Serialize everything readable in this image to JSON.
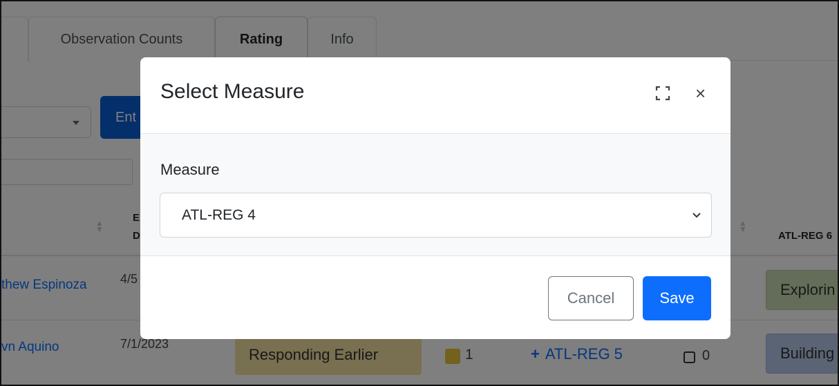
{
  "tabs": [
    {
      "label": ""
    },
    {
      "label": "Observation Counts"
    },
    {
      "label": "Rating"
    },
    {
      "label": "Info"
    }
  ],
  "toolbar": {
    "enter_label": "Ent"
  },
  "table": {
    "headers": {
      "col_date_top": "E",
      "col_date_bottom": "D",
      "col_atl_reg6": "ATL-REG 6"
    },
    "rows": [
      {
        "name": "thew Espinoza",
        "date": "4/5",
        "rating": "",
        "count": "",
        "add_label": "",
        "notes": "",
        "atl_reg6": "Explorin"
      },
      {
        "name": "vn Aquino",
        "date": "7/1/2023",
        "rating": "Responding Earlier",
        "count": "1",
        "add_label": "ATL-REG 5",
        "notes": "0",
        "atl_reg6": "Building"
      }
    ]
  },
  "modal": {
    "title": "Select Measure",
    "field_label": "Measure",
    "selected_value": "ATL-REG 4",
    "cancel_label": "Cancel",
    "save_label": "Save",
    "expand_icon": "expand-icon",
    "close_icon": "close-icon",
    "close_glyph": "×"
  },
  "colors": {
    "primary": "#0d6efd",
    "primary_dark": "#0b5ed7",
    "green_pill": "#c8dbb3",
    "blue_pill": "#b5c8e8",
    "yellow_pill": "#f2e0a2",
    "yellow_square": "#e7c23a"
  }
}
